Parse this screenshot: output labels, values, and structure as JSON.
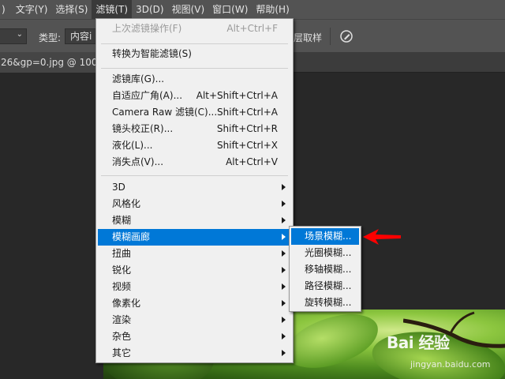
{
  "menubar": {
    "items": [
      {
        "label": ")"
      },
      {
        "label": "文字(Y)"
      },
      {
        "label": "选择(S)"
      },
      {
        "label": "滤镜(T)"
      },
      {
        "label": "3D(D)"
      },
      {
        "label": "视图(V)"
      },
      {
        "label": "窗口(W)"
      },
      {
        "label": "帮助(H)"
      }
    ]
  },
  "options": {
    "type_label": "类型:",
    "type_value": "内容i",
    "sample_label": "层取样",
    "pen_icon": "pen-icon"
  },
  "document": {
    "tab_title": "26&gp=0.jpg @ 100%"
  },
  "filter_menu": {
    "items": [
      {
        "label": "上次滤镜操作(F)",
        "shortcut": "Alt+Ctrl+F",
        "disabled": true
      },
      {
        "label": "转换为智能滤镜(S)"
      },
      {
        "label": "滤镜库(G)..."
      },
      {
        "label": "自适应广角(A)...",
        "shortcut": "Alt+Shift+Ctrl+A"
      },
      {
        "label": "Camera Raw 滤镜(C)...",
        "shortcut": "Shift+Ctrl+A"
      },
      {
        "label": "镜头校正(R)...",
        "shortcut": "Shift+Ctrl+R"
      },
      {
        "label": "液化(L)...",
        "shortcut": "Shift+Ctrl+X"
      },
      {
        "label": "消失点(V)...",
        "shortcut": "Alt+Ctrl+V"
      },
      {
        "label": "3D"
      },
      {
        "label": "风格化"
      },
      {
        "label": "模糊"
      },
      {
        "label": "模糊画廊",
        "highlighted": true
      },
      {
        "label": "扭曲"
      },
      {
        "label": "锐化"
      },
      {
        "label": "视频"
      },
      {
        "label": "像素化"
      },
      {
        "label": "渲染"
      },
      {
        "label": "杂色"
      },
      {
        "label": "其它"
      }
    ]
  },
  "blur_gallery_submenu": {
    "items": [
      {
        "label": "场景模糊...",
        "highlighted": true
      },
      {
        "label": "光圈模糊..."
      },
      {
        "label": "移轴模糊..."
      },
      {
        "label": "路径模糊..."
      },
      {
        "label": "旋转模糊..."
      }
    ]
  },
  "watermark": {
    "brand": "Bai 经验",
    "url": "jingyan.baidu.com"
  },
  "colors": {
    "highlight": "#0078d7",
    "menubar": "#535353",
    "canvas_bg": "#282828",
    "annotation_arrow": "#ff0000"
  }
}
